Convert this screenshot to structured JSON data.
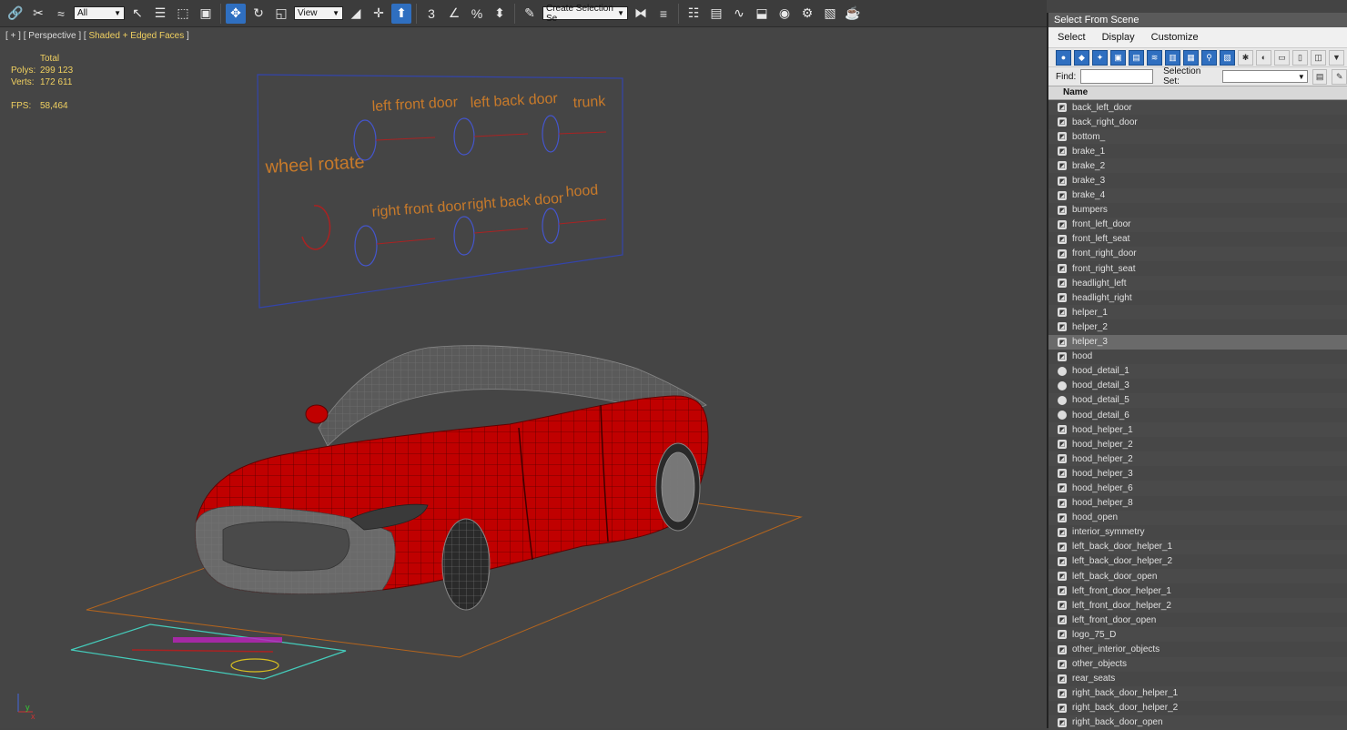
{
  "toolbar": {
    "filter_value": "All",
    "view_value": "View",
    "selection_set_placeholder": "Create Selection Se",
    "snap_label": "3"
  },
  "viewport": {
    "label_prefix": "[ + ] [ Perspective ] [",
    "label_shading": "Shaded + Edged Faces",
    "label_suffix": "]",
    "stats": {
      "total_label": "Total",
      "polys_label": "Polys:",
      "polys_value": "299 123",
      "verts_label": "Verts:",
      "verts_value": "172 611",
      "fps_label": "FPS:",
      "fps_value": "58,464"
    },
    "control_board": {
      "wheel_rotate": "wheel rotate",
      "left_front_door": "left front door",
      "left_back_door": "left back door",
      "trunk": "trunk",
      "right_front_door": "right front door",
      "right_back_door": "right back door",
      "hood": "hood"
    },
    "axis_x": "x",
    "axis_y": "y"
  },
  "panel": {
    "title": "Select From Scene",
    "menu": [
      "Select",
      "Display",
      "Customize"
    ],
    "find_label": "Find:",
    "selection_set_label": "Selection Set:",
    "column_name": "Name",
    "items": [
      "back_left_door",
      "back_right_door",
      "bottom_",
      "brake_1",
      "brake_2",
      "brake_3",
      "brake_4",
      "bumpers",
      "front_left_door",
      "front_left_seat",
      "front_right_door",
      "front_right_seat",
      "headlight_left",
      "headlight_right",
      "helper_1",
      "helper_2",
      "helper_3",
      "hood",
      "hood_detail_1",
      "hood_detail_3",
      "hood_detail_5",
      "hood_detail_6",
      "hood_helper_1",
      "hood_helper_2",
      "hood_helper_2",
      "hood_helper_3",
      "hood_helper_6",
      "hood_helper_8",
      "hood_open",
      "interior_symmetry",
      "left_back_door_helper_1",
      "left_back_door_helper_2",
      "left_back_door_open",
      "left_front_door_helper_1",
      "left_front_door_helper_2",
      "left_front_door_open",
      "logo_75_D",
      "other_interior_objects",
      "other_objects",
      "rear_seats",
      "right_back_door_helper_1",
      "right_back_door_helper_2",
      "right_back_door_open"
    ],
    "selected_index": 16
  },
  "colors": {
    "car_body": "#c00000",
    "accent_blue": "#2f6fc0",
    "label_orange": "#c87a2a",
    "stats_yellow": "#f0d060"
  }
}
